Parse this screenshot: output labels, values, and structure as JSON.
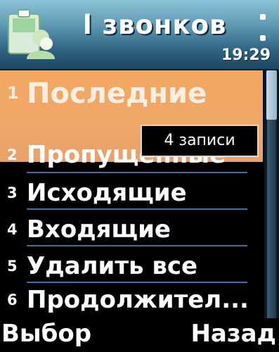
{
  "header": {
    "title": "l звонков",
    "time": "19:29",
    "icon": "phone-call-log-icon"
  },
  "menu": {
    "items": [
      {
        "number": "1",
        "label": "Последние",
        "selected": true
      },
      {
        "number": "2",
        "label": "Пропущенные",
        "selected": false
      },
      {
        "number": "3",
        "label": "Исходящие",
        "selected": false
      },
      {
        "number": "4",
        "label": "Входящие",
        "selected": false
      },
      {
        "number": "5",
        "label": "Удалить все",
        "selected": false
      },
      {
        "number": "6",
        "label": "Продолжител...",
        "selected": false
      }
    ]
  },
  "tooltip": {
    "text": "4 записи"
  },
  "softkeys": {
    "left": "Выбор",
    "right": "Назад"
  },
  "colors": {
    "highlight": "#f0a86a",
    "header_top": "#8ec3d8",
    "header_bottom": "#1c4763",
    "underline": "#3d6fa7",
    "background": "#000000"
  }
}
